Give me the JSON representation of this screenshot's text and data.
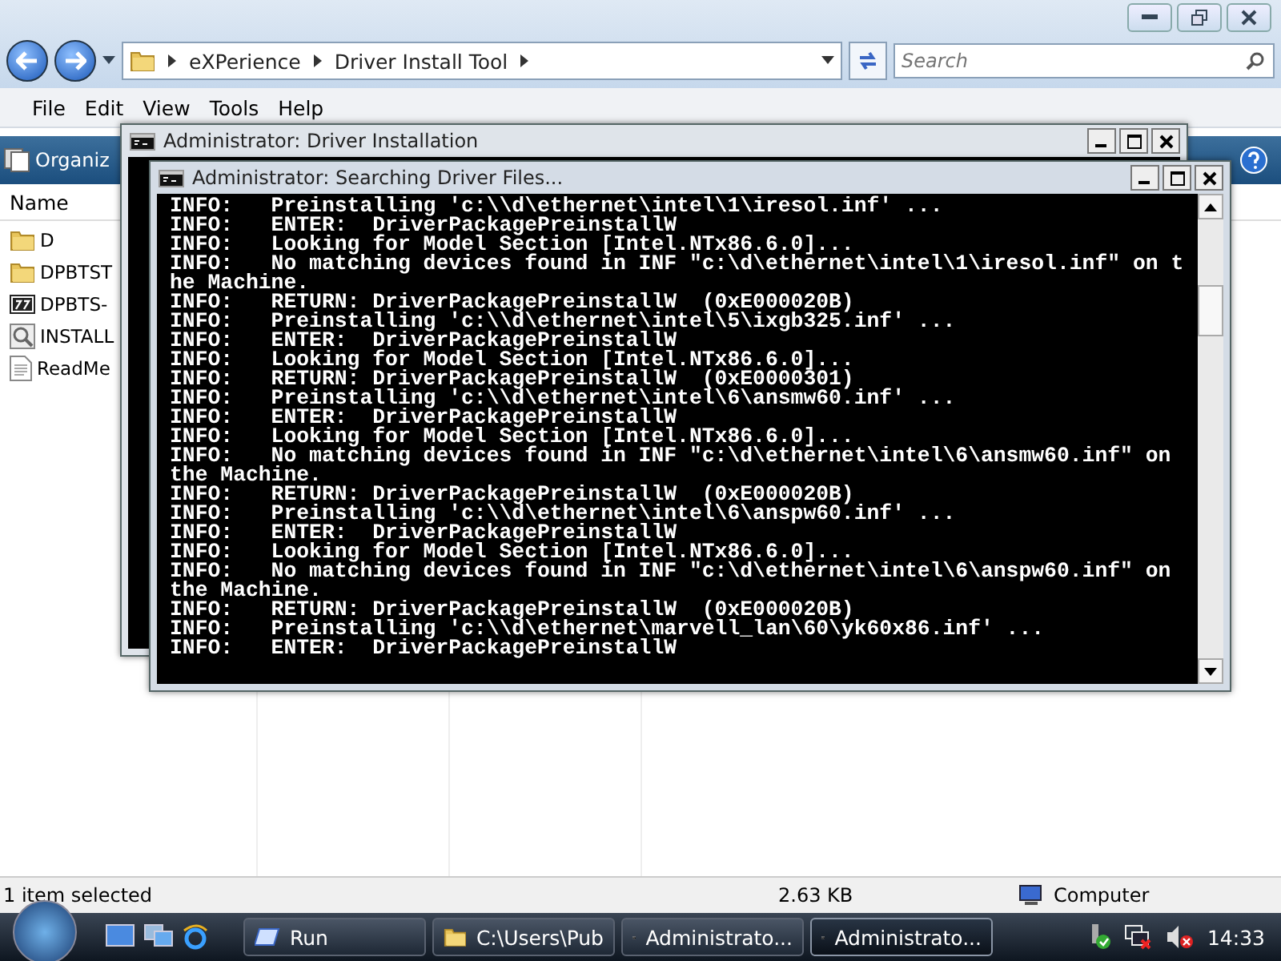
{
  "explorer": {
    "breadcrumbs": [
      "eXPerience",
      "Driver Install Tool"
    ],
    "search": {
      "placeholder": "Search"
    },
    "menu": [
      "File",
      "Edit",
      "View",
      "Tools",
      "Help"
    ],
    "toolbar": {
      "organize": "Organiz"
    },
    "columns": [
      "Name"
    ],
    "files": [
      {
        "name": "D",
        "kind": "folder"
      },
      {
        "name": "DPBTST",
        "kind": "folder"
      },
      {
        "name": "DPBTS-",
        "kind": "archive"
      },
      {
        "name": "INSTALL",
        "kind": "installer"
      },
      {
        "name": "ReadMe",
        "kind": "text"
      }
    ],
    "status_bar": {
      "selection": "1 item selected",
      "size": "2.63 KB",
      "zone": "Computer"
    }
  },
  "back_window": {
    "title": "Administrator: Driver Installation"
  },
  "console": {
    "title": "Administrator: Searching Driver Files...",
    "lines": [
      "INFO:   Preinstalling 'c:\\\\d\\ethernet\\intel\\1\\iresol.inf' ...",
      "INFO:   ENTER:  DriverPackagePreinstallW",
      "INFO:   Looking for Model Section [Intel.NTx86.6.0]...",
      "INFO:   No matching devices found in INF \"c:\\d\\ethernet\\intel\\1\\iresol.inf\" on t",
      "he Machine.",
      "INFO:   RETURN: DriverPackagePreinstallW  (0xE000020B)",
      "INFO:   Preinstalling 'c:\\\\d\\ethernet\\intel\\5\\ixgb325.inf' ...",
      "INFO:   ENTER:  DriverPackagePreinstallW",
      "INFO:   Looking for Model Section [Intel.NTx86.6.0]...",
      "INFO:   RETURN: DriverPackagePreinstallW  (0xE0000301)",
      "INFO:   Preinstalling 'c:\\\\d\\ethernet\\intel\\6\\ansmw60.inf' ...",
      "INFO:   ENTER:  DriverPackagePreinstallW",
      "INFO:   Looking for Model Section [Intel.NTx86.6.0]...",
      "INFO:   No matching devices found in INF \"c:\\d\\ethernet\\intel\\6\\ansmw60.inf\" on",
      "the Machine.",
      "INFO:   RETURN: DriverPackagePreinstallW  (0xE000020B)",
      "INFO:   Preinstalling 'c:\\\\d\\ethernet\\intel\\6\\anspw60.inf' ...",
      "INFO:   ENTER:  DriverPackagePreinstallW",
      "INFO:   Looking for Model Section [Intel.NTx86.6.0]...",
      "INFO:   No matching devices found in INF \"c:\\d\\ethernet\\intel\\6\\anspw60.inf\" on",
      "the Machine.",
      "INFO:   RETURN: DriverPackagePreinstallW  (0xE000020B)",
      "INFO:   Preinstalling 'c:\\\\d\\ethernet\\marvell_lan\\60\\yk60x86.inf' ...",
      "INFO:   ENTER:  DriverPackagePreinstallW"
    ]
  },
  "taskbar": {
    "buttons": [
      {
        "label": "Run",
        "kind": "run",
        "selected": false
      },
      {
        "label": "C:\\Users\\Pub",
        "kind": "folder",
        "selected": false
      },
      {
        "label": "Administrato...",
        "kind": "console",
        "selected": false
      },
      {
        "label": "Administrato...",
        "kind": "console",
        "selected": true
      }
    ],
    "clock": "14:33"
  }
}
